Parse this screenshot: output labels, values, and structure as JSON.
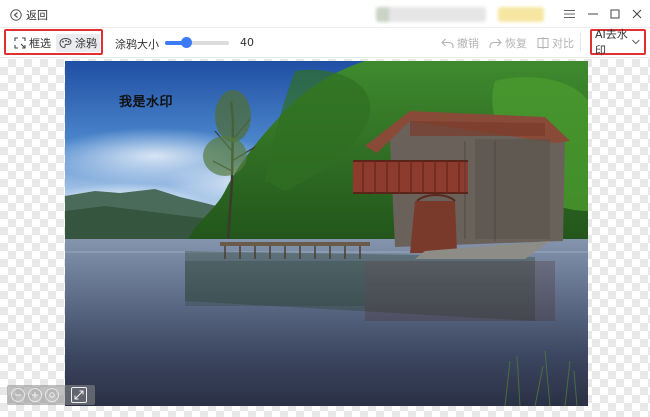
{
  "titlebar": {
    "back_label": "返回",
    "icons": [
      "arrow-left-icon",
      "menu-icon",
      "minimize-icon",
      "maximize-icon",
      "close-icon"
    ]
  },
  "toolbar": {
    "tools": [
      {
        "label": "框选",
        "icon": "rectangle-select-icon",
        "active": false
      },
      {
        "label": "涂鸦",
        "icon": "brush-icon",
        "active": true
      }
    ],
    "brush_size_label": "涂鸦大小",
    "brush_size_value": "40",
    "brush_size_level": 0.33,
    "actions": [
      {
        "label": "撤销",
        "icon": "undo-icon",
        "enabled": false
      },
      {
        "label": "恢复",
        "icon": "redo-icon",
        "enabled": false
      },
      {
        "label": "对比",
        "icon": "compare-icon",
        "enabled": false
      }
    ],
    "mode_select": {
      "value": "AI去水印",
      "icon": "chevron-down-icon"
    }
  },
  "canvas": {
    "watermark_text": "我是水印",
    "image_subject": "lake-boathouse-photo",
    "controls": [
      "zoom-out-icon",
      "zoom-in-icon",
      "reset-zoom-icon",
      "fit-screen-icon"
    ]
  },
  "colors": {
    "accent": "#3b7cf5",
    "highlight_border": "#e03030",
    "disabled_text": "#b3b3b3"
  }
}
